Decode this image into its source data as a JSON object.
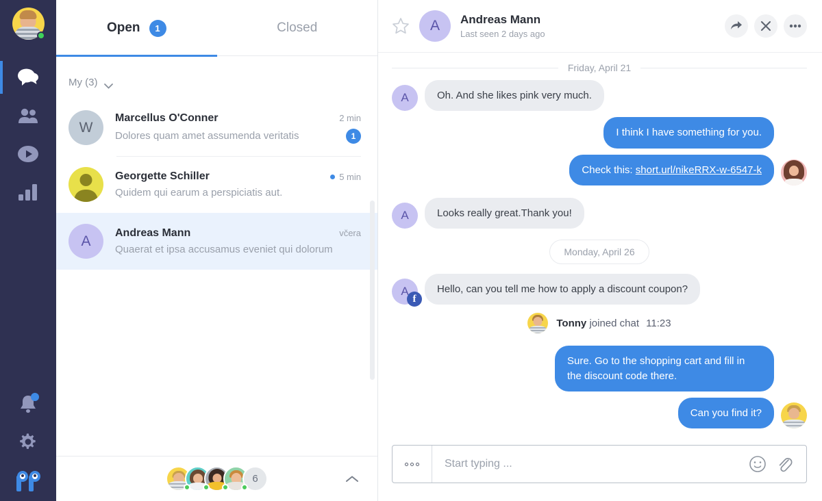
{
  "rail": {
    "profile": {
      "name": "current-user",
      "status": "online"
    },
    "items": [
      {
        "icon": "chat-bubbles-icon",
        "label": "Chats",
        "active": true
      },
      {
        "icon": "contacts-icon",
        "label": "Contacts",
        "active": false
      },
      {
        "icon": "play-circle-icon",
        "label": "Recordings",
        "active": false
      },
      {
        "icon": "bar-chart-icon",
        "label": "Statistics",
        "active": false
      }
    ],
    "bottom": [
      {
        "icon": "bell-icon",
        "label": "Notifications",
        "badge": true
      },
      {
        "icon": "gear-icon",
        "label": "Settings",
        "badge": false
      }
    ],
    "logo_label": "PP"
  },
  "list": {
    "tabs": [
      {
        "label": "Open",
        "badge": "1",
        "active": true
      },
      {
        "label": "Closed",
        "badge": "",
        "active": false
      }
    ],
    "group": {
      "label": "My (3)",
      "icon": "chevron-down-icon"
    },
    "conversations": [
      {
        "name": "Marcellus O'Conner",
        "preview": "Dolores quam amet assumenda veritatis",
        "time": "2 min",
        "unread": "1",
        "has_dot": false,
        "avatar_letter": "W",
        "avatar_bg": "#c2cdd8",
        "avatar_fg": "#5b6270",
        "avatar_type": "letter",
        "selected": false
      },
      {
        "name": "Georgette Schiller",
        "preview": "Quidem qui earum a perspiciatis aut.",
        "time": "5 min",
        "unread": "",
        "has_dot": true,
        "avatar_letter": "",
        "avatar_bg": "#e8e04a",
        "avatar_fg": "#8a8420",
        "avatar_type": "silhouette",
        "selected": false
      },
      {
        "name": "Andreas Mann",
        "preview": "Quaerat et ipsa accusamus eveniet qui dolorum",
        "time": "včera",
        "unread": "",
        "has_dot": false,
        "avatar_letter": "A",
        "avatar_bg": "#c7c3f2",
        "avatar_fg": "#5a54a8",
        "avatar_type": "letter",
        "selected": true
      }
    ],
    "footer": {
      "agents": [
        {
          "name": "agent-1",
          "bg": "#f7d54a",
          "hair": "#c9a04c",
          "skin": "#e9b78f",
          "shirt": "#cdd3da"
        },
        {
          "name": "agent-2",
          "bg": "#5ecfc8",
          "hair": "#6b4a33",
          "skin": "#eab995",
          "shirt": "#f0f2f4"
        },
        {
          "name": "agent-3",
          "bg": "#a8adb4",
          "hair": "#3b2a22",
          "skin": "#e7b089",
          "shirt": "#f2c02c"
        },
        {
          "name": "agent-4",
          "bg": "#8fd3a8",
          "hair": "#c98a3c",
          "skin": "#edbd96",
          "shirt": "#e8e4df"
        }
      ],
      "more_count": "6",
      "collapse_icon": "chevron-up-icon"
    }
  },
  "chat": {
    "header": {
      "star_icon": "star-outline-icon",
      "avatar_letter": "A",
      "name": "Andreas Mann",
      "subtitle": "Last seen 2 days ago",
      "actions": [
        {
          "icon": "forward-arrow-icon",
          "label": "Forward"
        },
        {
          "icon": "close-x-icon",
          "label": "Close"
        },
        {
          "icon": "ellipsis-icon",
          "label": "More"
        }
      ]
    },
    "separators": {
      "first": "Friday, April 21",
      "second": "Monday, April 26"
    },
    "messages": [
      {
        "id": "m1",
        "side": "in",
        "text": "Oh. And she likes pink very much.",
        "avatar_letter": "A",
        "show_avatar": true,
        "badge": "",
        "link": ""
      },
      {
        "id": "m2",
        "side": "out",
        "text": "I think I have something for you.",
        "avatar_letter": "",
        "show_avatar": false,
        "badge": "",
        "link": ""
      },
      {
        "id": "m3",
        "side": "out",
        "text": "Check this: ",
        "avatar_letter": "",
        "show_avatar": true,
        "badge": "",
        "link": "short.url/nikeRRX-w-6547-k",
        "avatar_kind": "photo-woman"
      },
      {
        "id": "m4",
        "side": "in",
        "text": "Looks really great.Thank you!",
        "avatar_letter": "A",
        "show_avatar": true,
        "badge": "",
        "link": ""
      },
      {
        "id": "m5",
        "side": "in",
        "text": "Hello, can you tell me how to apply a discount coupon?",
        "avatar_letter": "A",
        "show_avatar": true,
        "badge": "facebook-badge-icon",
        "link": ""
      },
      {
        "id": "m6",
        "side": "out",
        "text": "Sure. Go to the shopping cart and fill in the discount code there.",
        "avatar_letter": "",
        "show_avatar": false,
        "badge": "",
        "link": ""
      },
      {
        "id": "m7",
        "side": "out",
        "text": "Can you find it?",
        "avatar_letter": "",
        "show_avatar": true,
        "badge": "",
        "link": "",
        "avatar_kind": "photo-man"
      }
    ],
    "system_event": {
      "user": "Tonny",
      "action": "joined chat",
      "time": "11:23"
    },
    "composer": {
      "placeholder": "Start typing ...",
      "value": "",
      "left_icon": "quick-replies-icon",
      "emoji_icon": "emoji-smiley-icon",
      "attach_icon": "paperclip-icon"
    }
  },
  "colors": {
    "rail_bg": "#2f3152",
    "accent_blue": "#3e8ae5",
    "bubble_in": "#eaecf0",
    "bubble_out": "#3e8ae5",
    "selected_row": "#eaf2fd",
    "online_green": "#4ccb5c",
    "text_dark": "#2b2f38",
    "text_muted": "#9aa0ab"
  }
}
